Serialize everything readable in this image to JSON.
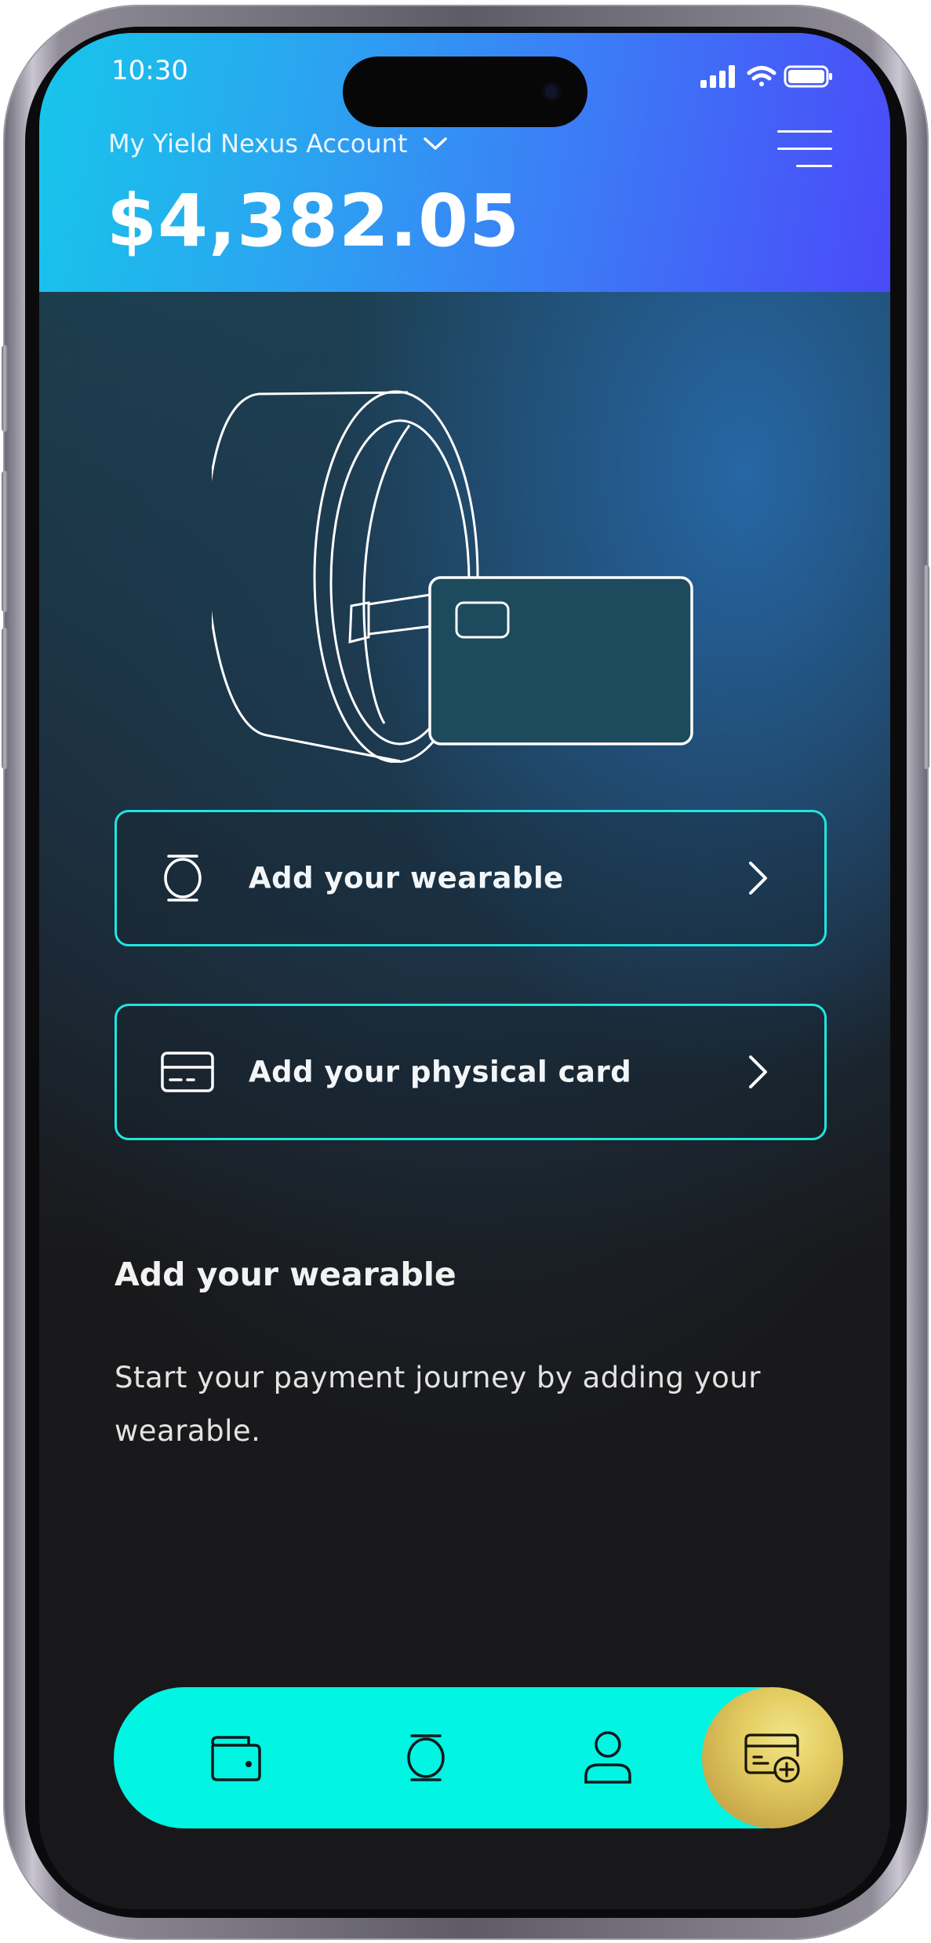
{
  "status_bar": {
    "time": "10:30"
  },
  "header": {
    "account_label": "My Yield Nexus Account",
    "balance": "$4,382.05"
  },
  "options": [
    {
      "label": "Add your wearable",
      "icon": "ring-icon"
    },
    {
      "label": "Add your physical card",
      "icon": "card-icon"
    }
  ],
  "info": {
    "title": "Add your wearable",
    "description": "Start your payment journey by adding your wearable."
  },
  "nav": {
    "items": [
      {
        "icon": "wallet-icon"
      },
      {
        "icon": "ring-icon"
      },
      {
        "icon": "user-icon"
      },
      {
        "icon": "add-card-icon",
        "active": true
      }
    ]
  },
  "colors": {
    "header_gradient_start": "#16c6ea",
    "header_gradient_end": "#4a4af8",
    "accent_cyan": "#00f5e3",
    "option_border": "#1fe6dd",
    "active_gold": "#e4cd62"
  }
}
